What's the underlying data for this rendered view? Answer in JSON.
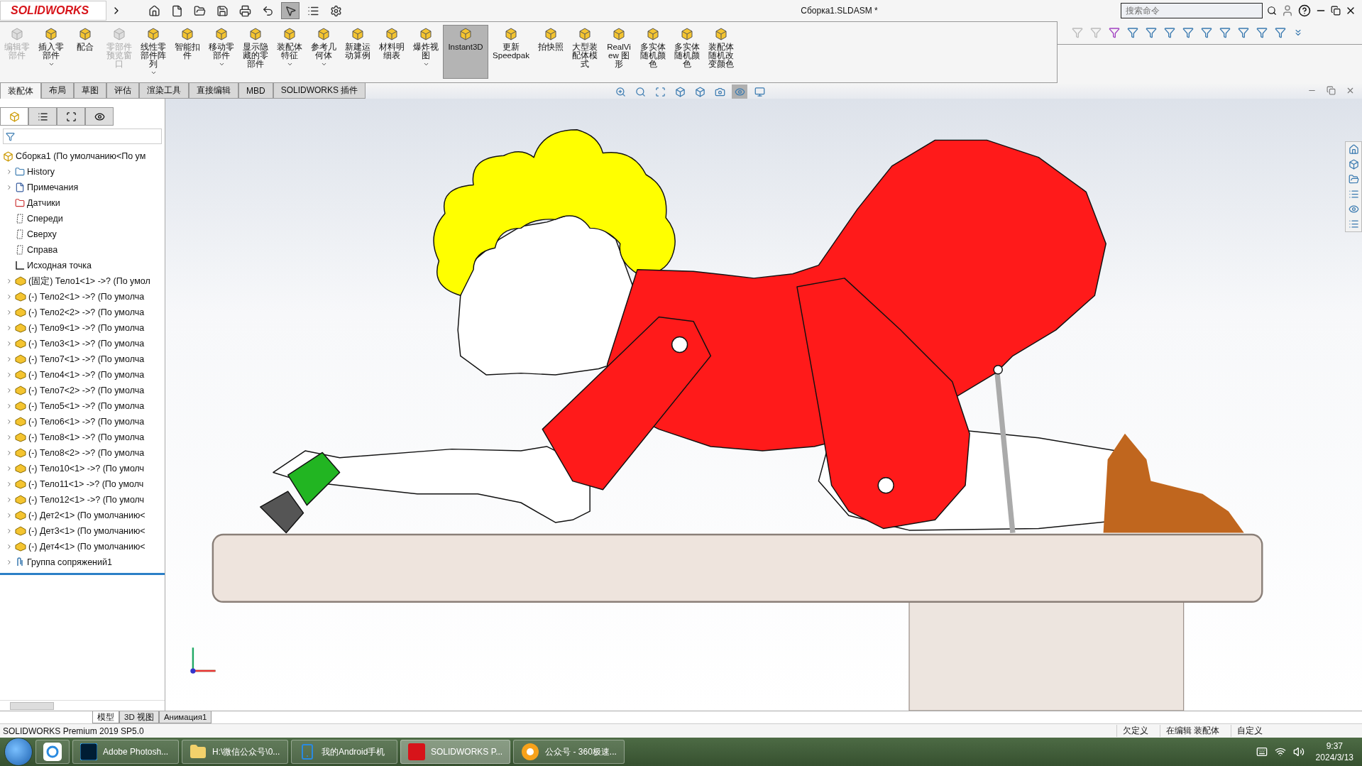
{
  "app": {
    "logo": "SOLIDWORKS",
    "title": "Сборка1.SLDASM *",
    "search": {
      "placeholder": "搜索命令"
    },
    "select_tool_active": true
  },
  "ribbon": {
    "commands": [
      {
        "label": "编辑零部件",
        "disabled": true,
        "active": false,
        "dropdown": false
      },
      {
        "label": "插入零部件",
        "disabled": false,
        "active": false,
        "dropdown": true
      },
      {
        "label": "配合",
        "disabled": false,
        "active": false,
        "dropdown": false
      },
      {
        "label": "零部件预览窗口",
        "disabled": true,
        "active": false,
        "dropdown": false
      },
      {
        "label": "线性零部件阵列",
        "disabled": false,
        "active": false,
        "dropdown": true
      },
      {
        "label": "智能扣件",
        "disabled": false,
        "active": false,
        "dropdown": false
      },
      {
        "label": "移动零部件",
        "disabled": false,
        "active": false,
        "dropdown": true
      },
      {
        "label": "显示隐藏的零部件",
        "disabled": false,
        "active": false,
        "dropdown": false
      },
      {
        "label": "装配体特征",
        "disabled": false,
        "active": false,
        "dropdown": true
      },
      {
        "label": "参考几何体",
        "disabled": false,
        "active": false,
        "dropdown": true
      },
      {
        "label": "新建运动算例",
        "disabled": false,
        "active": false,
        "dropdown": false
      },
      {
        "label": "材料明细表",
        "disabled": false,
        "active": false,
        "dropdown": false
      },
      {
        "label": "爆炸视图",
        "disabled": false,
        "active": false,
        "dropdown": true
      },
      {
        "label": "Instant3D",
        "disabled": false,
        "active": true,
        "dropdown": false
      },
      {
        "label": "更新 Speedpak",
        "disabled": false,
        "active": false,
        "dropdown": false
      },
      {
        "label": "拍快照",
        "disabled": false,
        "active": false,
        "dropdown": false
      },
      {
        "label": "大型装配体模式",
        "disabled": false,
        "active": false,
        "dropdown": false
      },
      {
        "label": "RealView 图形",
        "disabled": false,
        "active": false,
        "dropdown": false
      },
      {
        "label": "多实体随机颜色",
        "disabled": false,
        "active": false,
        "dropdown": false
      },
      {
        "label": "多实体随机颜色",
        "disabled": false,
        "active": false,
        "dropdown": false
      },
      {
        "label": "装配体随机改变颜色",
        "disabled": false,
        "active": false,
        "dropdown": false
      }
    ]
  },
  "tabs": [
    {
      "label": "装配体",
      "selected": true
    },
    {
      "label": "布局",
      "selected": false
    },
    {
      "label": "草图",
      "selected": false
    },
    {
      "label": "评估",
      "selected": false
    },
    {
      "label": "渲染工具",
      "selected": false
    },
    {
      "label": "直接编辑",
      "selected": false
    },
    {
      "label": "MBD",
      "selected": false
    },
    {
      "label": "SOLIDWORKS 插件",
      "selected": false
    }
  ],
  "tree": {
    "label": "Сборка1  (По умолчанию<По ум",
    "children": [
      {
        "kind": "history",
        "label": "History",
        "expandable": true
      },
      {
        "kind": "notes",
        "label": "Примечания",
        "expandable": true
      },
      {
        "kind": "sensors",
        "label": "Датчики",
        "expandable": false
      },
      {
        "kind": "plane",
        "label": "Спереди",
        "expandable": false
      },
      {
        "kind": "plane",
        "label": "Сверху",
        "expandable": false
      },
      {
        "kind": "plane",
        "label": "Справа",
        "expandable": false
      },
      {
        "kind": "origin",
        "label": "Исходная точка",
        "expandable": false
      },
      {
        "kind": "part",
        "label": "(固定) Тело1<1> ->? (По умол",
        "expandable": true
      },
      {
        "kind": "part",
        "label": "(-) Тело2<1> ->? (По умолча",
        "expandable": true
      },
      {
        "kind": "part",
        "label": "(-) Тело2<2> ->? (По умолча",
        "expandable": true
      },
      {
        "kind": "part",
        "label": "(-) Тело9<1> ->? (По умолча",
        "expandable": true
      },
      {
        "kind": "part",
        "label": "(-) Тело3<1> ->? (По умолча",
        "expandable": true
      },
      {
        "kind": "part",
        "label": "(-) Тело7<1> ->? (По умолча",
        "expandable": true
      },
      {
        "kind": "part",
        "label": "(-) Тело4<1> ->? (По умолча",
        "expandable": true
      },
      {
        "kind": "part",
        "label": "(-) Тело7<2> ->? (По умолча",
        "expandable": true
      },
      {
        "kind": "part",
        "label": "(-) Тело5<1> ->? (По умолча",
        "expandable": true
      },
      {
        "kind": "part",
        "label": "(-) Тело6<1> ->? (По умолча",
        "expandable": true
      },
      {
        "kind": "part",
        "label": "(-) Тело8<1> ->? (По умолча",
        "expandable": true
      },
      {
        "kind": "part",
        "label": "(-) Тело8<2> ->? (По умолча",
        "expandable": true
      },
      {
        "kind": "part",
        "label": "(-) Тело10<1> ->? (По умолч",
        "expandable": true
      },
      {
        "kind": "part",
        "label": "(-) Тело11<1> ->? (По умолч",
        "expandable": true
      },
      {
        "kind": "part",
        "label": "(-) Тело12<1> ->? (По умолч",
        "expandable": true
      },
      {
        "kind": "part",
        "label": "(-) Дет2<1> (По умолчанию<",
        "expandable": true
      },
      {
        "kind": "part",
        "label": "(-) Дет3<1> (По умолчанию<",
        "expandable": true
      },
      {
        "kind": "part",
        "label": "(-) Дет4<1> (По умолчанию<",
        "expandable": true
      },
      {
        "kind": "mates",
        "label": "Группа сопряжений1",
        "expandable": true
      }
    ]
  },
  "bottom_tabs": [
    {
      "label": "模型",
      "selected": true
    },
    {
      "label": "3D 视图",
      "selected": false
    },
    {
      "label": "Анимация1",
      "selected": false
    }
  ],
  "status_bar": {
    "product": "SOLIDWORKS Premium 2019 SP5.0",
    "fields": [
      "欠定义",
      "在编辑 装配体",
      "自定义"
    ]
  },
  "taskbar": {
    "apps": [
      {
        "kind": "icon",
        "selected": false
      },
      {
        "kind": "ps",
        "label": "Adobe Photosh...",
        "selected": false
      },
      {
        "kind": "folder",
        "label": "H:\\微信公众号\\0...",
        "selected": false
      },
      {
        "kind": "phone",
        "label": "我的Android手机",
        "selected": false
      },
      {
        "kind": "sw",
        "label": "SOLIDWORKS P...",
        "selected": true
      },
      {
        "kind": "browser",
        "label": "公众号 - 360极速...",
        "selected": false
      }
    ],
    "time": "9:37",
    "date": "2024/3/13"
  }
}
